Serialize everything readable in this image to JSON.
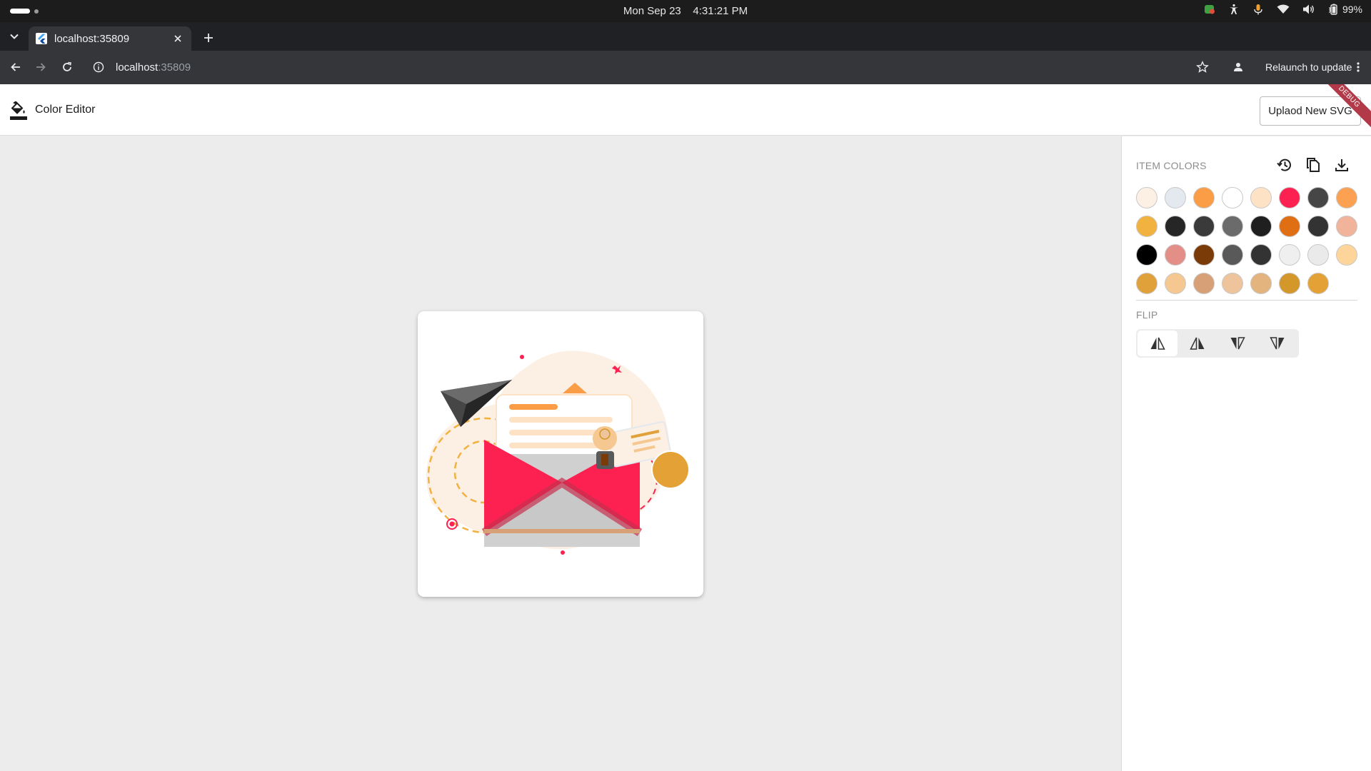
{
  "os": {
    "date": "Mon Sep 23",
    "time": "4:31:21 PM",
    "battery": "99%"
  },
  "browser": {
    "tab_title": "localhost:35809",
    "url_host": "localhost",
    "url_port": ":35809",
    "relaunch_label": "Relaunch to update"
  },
  "app": {
    "title": "Color Editor",
    "upload_label": "Uplaod New SVG",
    "debug_banner": "DEBUG"
  },
  "panel": {
    "item_colors_label": "ITEM COLORS",
    "flip_label": "FLIP",
    "swatches": [
      "#fcefe4",
      "#e3e9ef",
      "#fb9d46",
      "#ffffff",
      "#fde2c6",
      "#fc2150",
      "#464646",
      "#fca152",
      "#f2b23f",
      "#262626",
      "#3a3a3a",
      "#6b6b6b",
      "#1f1f1f",
      "#df6f12",
      "#333333",
      "#f1b39a",
      "#000000",
      "#e38f87",
      "#7b3b08",
      "#595959",
      "#333333",
      "#efefef",
      "#eaeaea",
      "#fdd59a",
      "#e1a13a",
      "#f4c890",
      "#d7a077",
      "#edc49b",
      "#e3b47d",
      "#d3972a",
      "#e4a135"
    ]
  }
}
